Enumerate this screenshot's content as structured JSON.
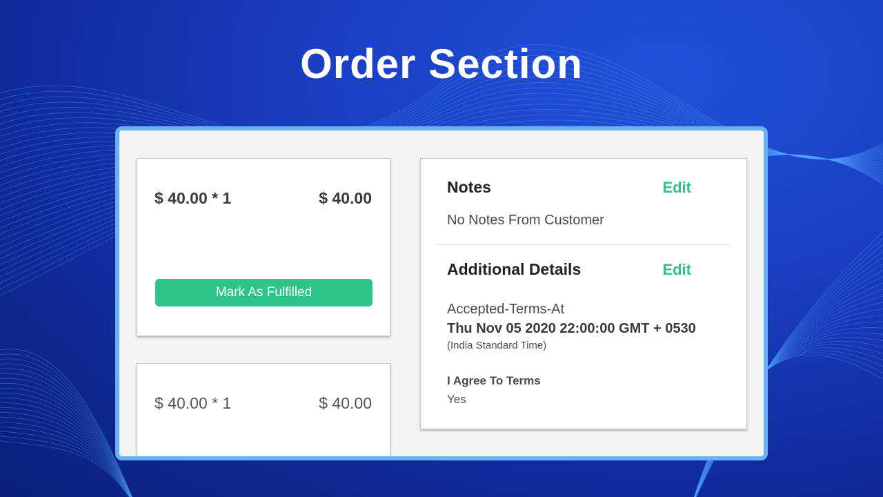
{
  "page": {
    "title": "Order Section"
  },
  "line_items": [
    {
      "price_qty": "$ 40.00 * 1",
      "total": "$ 40.00",
      "action_label": "Mark As Fulfilled"
    },
    {
      "price_qty": "$ 40.00 * 1",
      "total": "$ 40.00"
    }
  ],
  "notes": {
    "title": "Notes",
    "edit_label": "Edit",
    "text": "No Notes From Customer"
  },
  "additional_details": {
    "title": "Additional Details",
    "edit_label": "Edit",
    "accepted_terms_label": "Accepted-Terms-At",
    "accepted_terms_value": "Thu Nov 05 2020 22:00:00 GMT + 0530",
    "accepted_terms_timezone": "(India Standard Time)",
    "agree_label": "I Agree To Terms",
    "agree_value": "Yes"
  },
  "colors": {
    "accent": "#2cc488",
    "panel_border": "#6ab0f5",
    "background": "#1a3fc4"
  }
}
